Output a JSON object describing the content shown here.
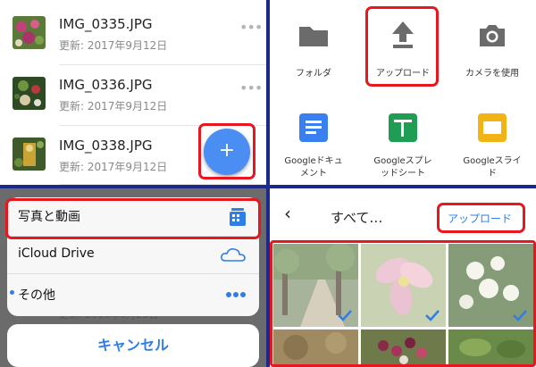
{
  "files": [
    {
      "name": "IMG_0335.JPG",
      "date": "更新: 2017年9月12日"
    },
    {
      "name": "IMG_0336.JPG",
      "date": "更新: 2017年9月12日"
    },
    {
      "name": "IMG_0338.JPG",
      "date": "更新: 2017年9月12日"
    }
  ],
  "fab": {
    "label": "+"
  },
  "new_menu": {
    "items": [
      {
        "label": "フォルダ",
        "icon": "folder-icon"
      },
      {
        "label": "アップロード",
        "icon": "upload-icon"
      },
      {
        "label": "カメラを使用",
        "icon": "camera-icon"
      },
      {
        "label": "Googleドキュメント",
        "line1": "Googleドキュ",
        "line2": "メント",
        "icon": "google-docs-icon"
      },
      {
        "label": "Googleスプレッドシート",
        "line1": "Googleスプレ",
        "line2": "ッドシート",
        "icon": "google-sheets-icon"
      },
      {
        "label": "Googleスライド",
        "line1": "Googleスライ",
        "line2": "ド",
        "icon": "google-slides-icon"
      }
    ]
  },
  "source_sheet": {
    "items": [
      {
        "label": "写真と動画",
        "icon": "photo-library-icon"
      },
      {
        "label": "iCloud Drive",
        "icon": "cloud-icon"
      },
      {
        "label": "その他",
        "icon": "more-icon"
      }
    ],
    "cancel_label": "キャンセル",
    "background_date": "更新: 2016年6月23日"
  },
  "photo_picker": {
    "back": "‹",
    "title": "すべて…",
    "upload_label": "アップロード",
    "photos": [
      {
        "selected": true,
        "subject": "tree-lined-path"
      },
      {
        "selected": true,
        "subject": "pink-lily"
      },
      {
        "selected": true,
        "subject": "white-flowers"
      },
      {
        "selected": false,
        "subject": "foliage"
      },
      {
        "selected": false,
        "subject": "berries"
      },
      {
        "selected": false,
        "subject": "green-leaves"
      }
    ]
  },
  "colors": {
    "accent": "#4a8ef3",
    "link": "#2f7ee8",
    "highlight": "#e8171f",
    "divider_bg": "#1b2a8a"
  }
}
